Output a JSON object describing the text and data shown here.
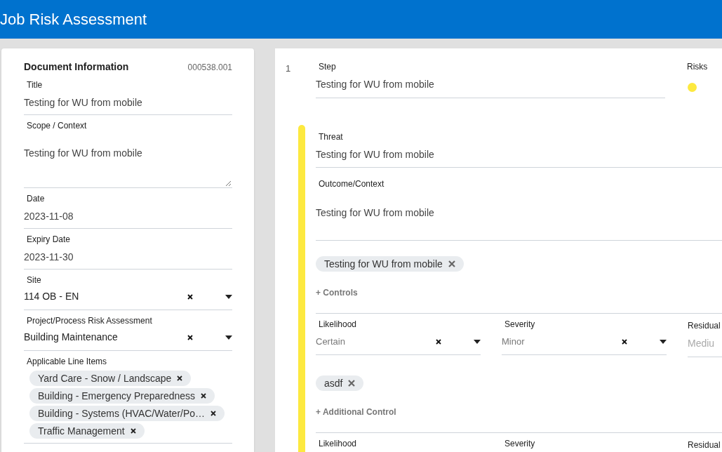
{
  "header": {
    "title": "Job Risk Assessment"
  },
  "document": {
    "heading": "Document Information",
    "number": "000538.001",
    "fields": [
      {
        "kind": "text",
        "label": "Title",
        "value": "Testing for WU from mobile"
      },
      {
        "kind": "textarea",
        "label": "Scope / Context",
        "value": "Testing for WU from mobile"
      },
      {
        "kind": "text",
        "label": "Date",
        "value": "2023-11-08"
      },
      {
        "kind": "text",
        "label": "Expiry Date",
        "value": "2023-11-30"
      },
      {
        "kind": "select",
        "label": "Site",
        "value": "114 OB - EN"
      },
      {
        "kind": "select",
        "label": "Project/Process Risk Assessment",
        "value": "Building Maintenance"
      }
    ],
    "line_items": {
      "label": "Applicable Line Items",
      "chips": [
        "Yard Care - Snow / Landscape",
        "Building - Emergency Preparedness",
        "Building - Systems (HVAC/Water/Po…",
        "Traffic Management"
      ]
    }
  },
  "step": {
    "number": "1",
    "label": "Step",
    "value": "Testing for WU from mobile",
    "risks_label": "Risks",
    "risks": [
      {
        "color": "#fde93f"
      }
    ],
    "threat": {
      "color": "#fde93f",
      "threat_label": "Threat",
      "threat_value": "Testing for WU from mobile",
      "outcome_label": "Outcome/Context",
      "outcome_value": "Testing for WU from mobile",
      "sections": [
        {
          "chips": [
            "Testing for WU from mobile"
          ],
          "link": "+ Controls",
          "ratings": {
            "likelihood_label": "Likelihood",
            "likelihood": "Certain",
            "severity_label": "Severity",
            "severity": "Minor",
            "residual_label": "Residual",
            "residual": "Mediu"
          }
        },
        {
          "chips": [
            "asdf"
          ],
          "link": "+ Additional Control",
          "ratings": {
            "likelihood_label": "Likelihood",
            "severity_label": "Severity",
            "residual_label": "Residual"
          }
        }
      ]
    }
  }
}
